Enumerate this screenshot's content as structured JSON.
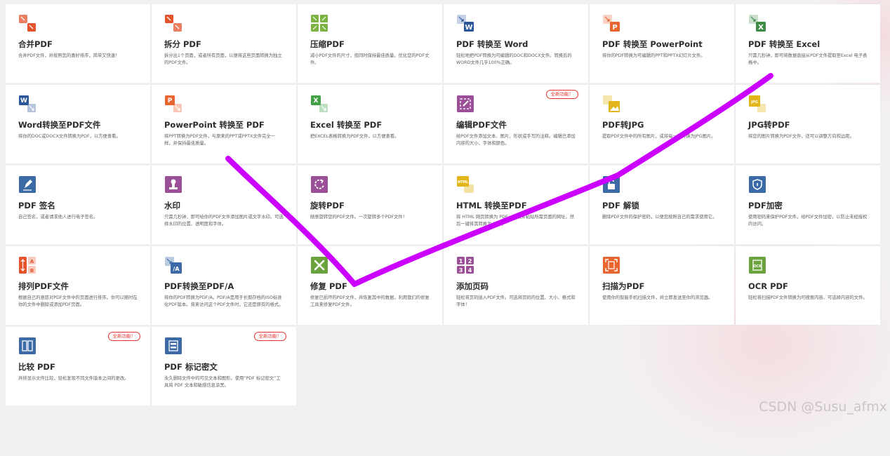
{
  "tools": [
    {
      "title": "合并PDF",
      "desc": "合并PDF文件，并按照您的喜好排序，简单又快速！",
      "icon": "merge-icon",
      "badge": ""
    },
    {
      "title": "拆分 PDF",
      "desc": "拆分出1个页面，或者所有页面，以便将这些页面转换为独立的PDF文件。",
      "icon": "split-icon",
      "badge": ""
    },
    {
      "title": "压缩PDF",
      "desc": "减小PDF文件的尺寸，但同时保持最佳质量。优化您的PDF文件。",
      "icon": "compress-icon",
      "badge": ""
    },
    {
      "title": "PDF 转换至 Word",
      "desc": "轻松地把PDF转换为可编辑的DOC和DOCX文件。转换后的WORD文件几乎100%正确。",
      "icon": "pdf-to-word-icon",
      "badge": ""
    },
    {
      "title": "PDF 转换至 PowerPoint",
      "desc": "将你的PDF转换为可编辑的PPT和PPTX幻灯片文件。",
      "icon": "pdf-to-powerpoint-icon",
      "badge": ""
    },
    {
      "title": "PDF 转换至 Excel",
      "desc": "只需几秒钟，即可将数据直接从PDF文件提取至Excel 电子表格中。",
      "icon": "pdf-to-excel-icon",
      "badge": ""
    },
    {
      "title": "Word转换至PDF文件",
      "desc": "将你的DOC或DOCX文件转换为PDF，以方便查看。",
      "icon": "word-to-pdf-icon",
      "badge": ""
    },
    {
      "title": "PowerPoint 转换至 PDF",
      "desc": "将PPT转换为PDF文件，与原来的PPT或PPTX文件完全一样，并保持最佳质量。",
      "icon": "powerpoint-to-pdf-icon",
      "badge": ""
    },
    {
      "title": "Excel 转换至 PDF",
      "desc": "把EXCEL表格转换为PDF文件，以方便查看。",
      "icon": "excel-to-pdf-icon",
      "badge": ""
    },
    {
      "title": "编辑PDF文件",
      "desc": "给PDF文件添加文本、图片、形状或手写的注释。编辑已添加内容的大小、字体和颜色。",
      "icon": "edit-pdf-icon",
      "badge": "全新功能！"
    },
    {
      "title": "PDF转JPG",
      "desc": "提取PDF文件中的所有图片，或将每一页转换为JPG图片。",
      "icon": "pdf-to-jpg-icon",
      "badge": ""
    },
    {
      "title": "JPG转PDF",
      "desc": "将您的图片转换为PDF文件，还可以调整方向和边距。",
      "icon": "jpg-to-pdf-icon",
      "badge": ""
    },
    {
      "title": "PDF 签名",
      "desc": "自己签名，或者请求他人进行电子签名。",
      "icon": "sign-pdf-icon",
      "badge": ""
    },
    {
      "title": "水印",
      "desc": "只需几秒钟，即可给你的PDF文件添加图片或文字水印。可选择水印的位置、透明度和字体。",
      "icon": "watermark-icon",
      "badge": ""
    },
    {
      "title": "旋转PDF",
      "desc": "随意旋转您的PDF文件。一次旋转多个PDF文件！",
      "icon": "rotate-pdf-icon",
      "badge": ""
    },
    {
      "title": "HTML 转换至PDF",
      "desc": "将 HTML 网页转换为 PDF。复制并粘贴所需页面的网址，然后一键将其转换为 PDF。",
      "icon": "html-to-pdf-icon",
      "badge": ""
    },
    {
      "title": "PDF 解锁",
      "desc": "删除PDF文件的保护密码，以便您按照自己的需求使用它。",
      "icon": "unlock-pdf-icon",
      "badge": ""
    },
    {
      "title": "PDF加密",
      "desc": "使用密码来保护PDF文件。给PDF文件加密，以防止未经授权的访问。",
      "icon": "protect-pdf-icon",
      "badge": ""
    },
    {
      "title": "排列PDF文件",
      "desc": "根据自己的意愿对PDF文件中的页面进行排序。你可以随时在你的文件中删除或添加PDF页面。",
      "icon": "organize-pdf-icon",
      "badge": ""
    },
    {
      "title": "PDF转换至PDF/A",
      "desc": "将你的PDF转换为PDF/A。PDF/A是用于长期存档的ISO标准化PDF版本。将来访问这个PDF文件时，它还是原有的格式。",
      "icon": "pdf-to-pdfa-icon",
      "badge": ""
    },
    {
      "title": "修复 PDF",
      "desc": "修复已损坏的PDF文件，并恢复其中的数据。利用我们的修复工具来修复PDF文件。",
      "icon": "repair-pdf-icon",
      "badge": ""
    },
    {
      "title": "添加页码",
      "desc": "轻松将页码插入PDF文件。可选择页码的位置、大小、格式和字体！",
      "icon": "page-numbers-icon",
      "badge": ""
    },
    {
      "title": "扫描为PDF",
      "desc": "使用你的智能手机扫描文件，并立即发送至你的浏览器。",
      "icon": "scan-to-pdf-icon",
      "badge": ""
    },
    {
      "title": "OCR PDF",
      "desc": "轻松将扫描PDF文件转换为可搜索内容、可选择内容的文件。",
      "icon": "ocr-pdf-icon",
      "badge": ""
    },
    {
      "title": "比较 PDF",
      "desc": "并排显示文件比较，轻松发现不同文件版本之间的更改。",
      "icon": "compare-pdf-icon",
      "badge": "全新功能！"
    },
    {
      "title": "PDF 标记密文",
      "desc": "永久删除文件中的可见文本和图形。使用“PDF 标记密文”工具将 PDF 文本和敏感信息涂黑。",
      "icon": "redact-pdf-icon",
      "badge": "全新功能！"
    }
  ],
  "icon_text": {
    "word": "W",
    "powerpoint": "P",
    "excel": "X",
    "html": "HTML",
    "jpg": "JPG",
    "pdfa": "/A",
    "organize_a": "A",
    "organize_b": "B",
    "ocr": "OCR",
    "n1": "1",
    "n2": "2",
    "n3": "3",
    "n4": "4"
  },
  "watermark": "CSDN @Susu_afmx",
  "colors": {
    "red": "#e5532d",
    "green": "#7cb342",
    "blue": "#2b579a",
    "orange": "#e8652f",
    "yellow": "#e2b619",
    "purple": "#9b4f96",
    "navy": "#3b6aa6",
    "annotation": "#cc00ff"
  }
}
